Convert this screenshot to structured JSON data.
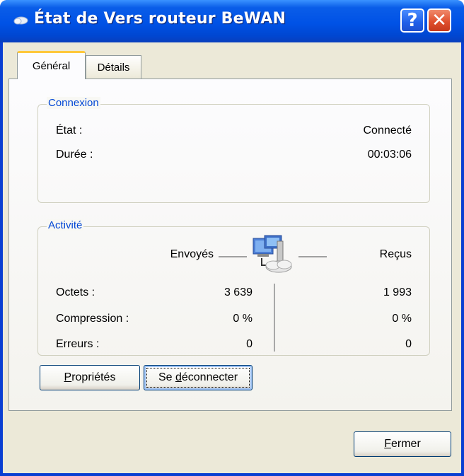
{
  "window": {
    "title": "État de Vers routeur BeWAN",
    "help_button": "?",
    "close_button": "✕"
  },
  "tabs": [
    {
      "label": "Général",
      "selected": true
    },
    {
      "label": "Détails",
      "selected": false
    }
  ],
  "connexion": {
    "legend": "Connexion",
    "state_label": "État :",
    "state_value": "Connecté",
    "duration_label": "Durée :",
    "duration_value": "00:03:06"
  },
  "activity": {
    "legend": "Activité",
    "sent_header": "Envoyés",
    "received_header": "Reçus",
    "rows": [
      {
        "label": "Octets :",
        "sent": "3 639",
        "received": "1 993"
      },
      {
        "label": "Compression :",
        "sent": "0 %",
        "received": "0 %"
      },
      {
        "label": "Erreurs :",
        "sent": "0",
        "received": "0"
      }
    ],
    "icon": "network-computers-icon"
  },
  "buttons": {
    "properties": {
      "prefix": "",
      "mnemonic": "P",
      "rest": "ropriétés"
    },
    "disconnect": {
      "prefix": "Se ",
      "mnemonic": "d",
      "rest": "éconnecter"
    },
    "close": {
      "prefix": "",
      "mnemonic": "F",
      "rest": "ermer"
    }
  },
  "colors": {
    "titlebar": "#0052e6",
    "legend_text": "#0046d5",
    "client_bg": "#ece9d8",
    "close_button": "#e0502e",
    "active_tab_accent": "#ffc83c"
  }
}
